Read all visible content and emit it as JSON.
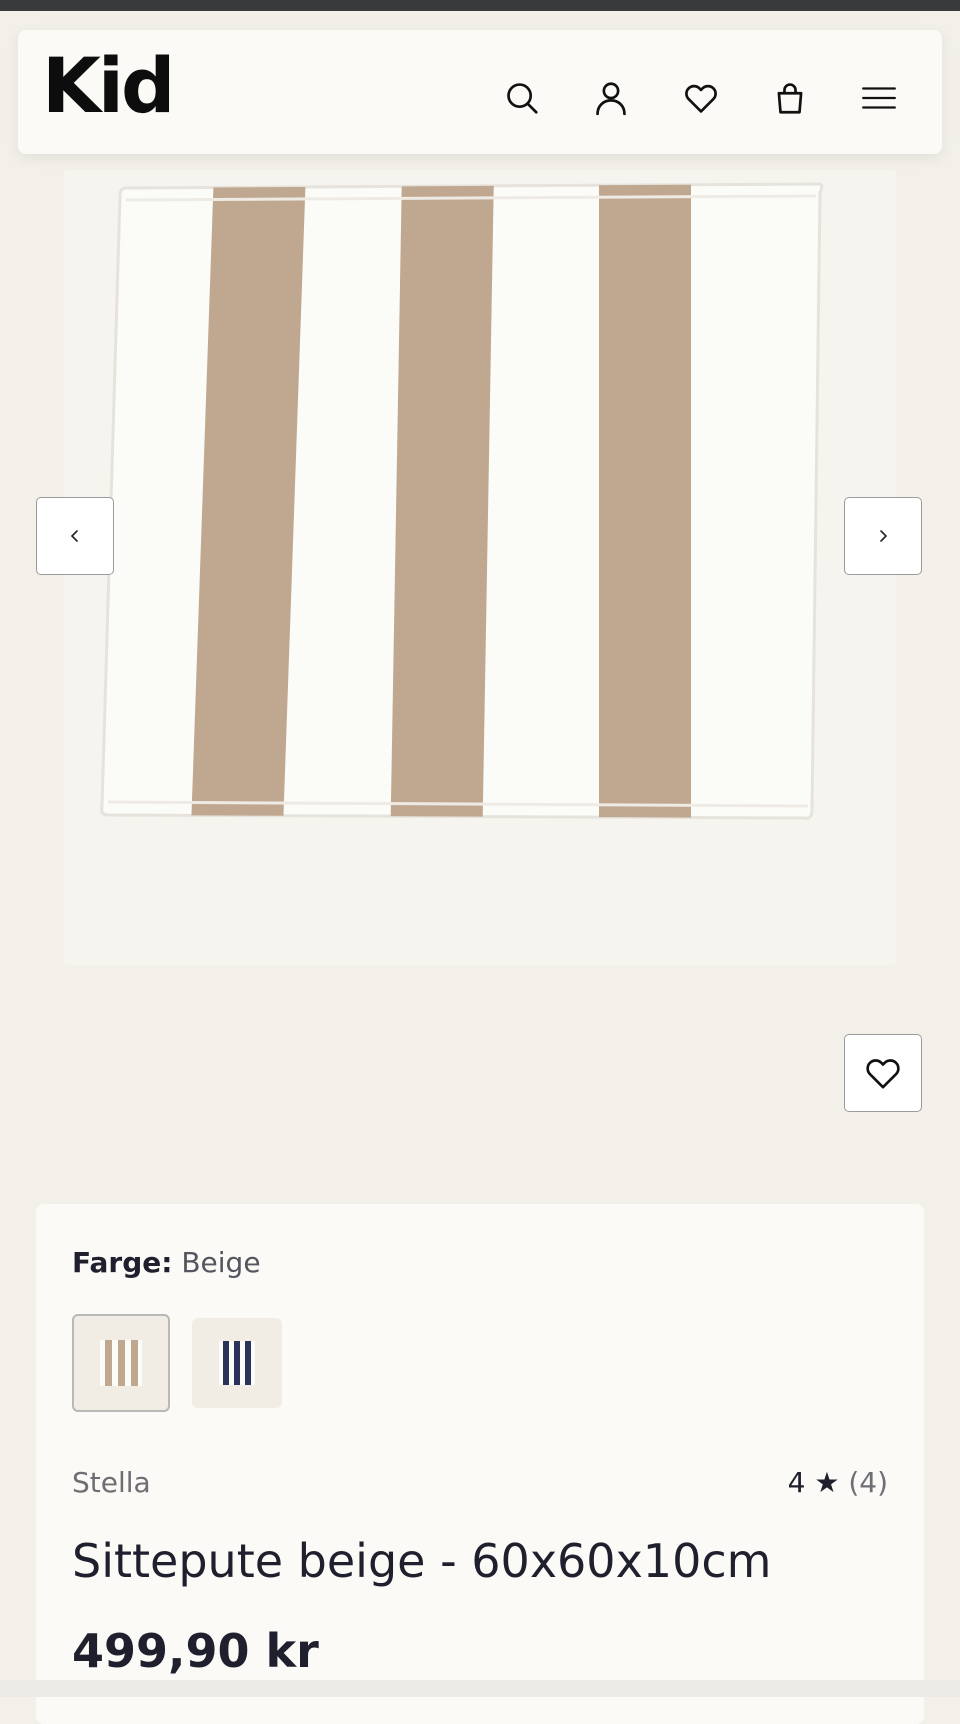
{
  "header": {
    "logo": "Kid",
    "icons": [
      "search-icon",
      "account-icon",
      "heart-icon",
      "bag-icon",
      "menu-icon"
    ]
  },
  "product": {
    "color_label": "Farge:",
    "color_value": "Beige",
    "swatches": [
      "Beige",
      "Navy"
    ],
    "brand": "Stella",
    "rating_value": "4",
    "rating_star": "★",
    "rating_count": "(4)",
    "title": "Sittepute beige - 60x60x10cm",
    "price": "499,90 kr"
  },
  "colors": {
    "background": "#f3f0ea",
    "card": "#fbfaf6",
    "stripe_beige": "#bfa88f",
    "stripe_navy": "#2b3458",
    "text": "#1f1f2e"
  }
}
